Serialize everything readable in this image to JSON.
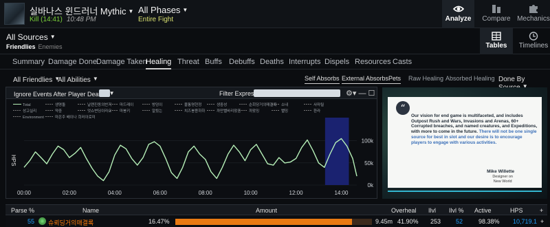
{
  "header": {
    "boss_title": "실바나스 윈드러너 Mythic",
    "kill_status": "Kill (14:41)",
    "kill_time": "10:48 PM",
    "phase_title": "All Phases",
    "phase_subtitle": "Entire Fight",
    "nav": [
      {
        "label": "Analyze",
        "icon": "eye-icon"
      },
      {
        "label": "Compare",
        "icon": "compare-icon"
      },
      {
        "label": "Mechanics",
        "icon": "puzzle-icon"
      }
    ]
  },
  "sources": {
    "title": "All Sources",
    "friendlies": "Friendlies",
    "enemies": "Enemies",
    "views": [
      {
        "label": "Tables",
        "icon": "table-icon"
      },
      {
        "label": "Timelines",
        "icon": "clock-icon"
      }
    ]
  },
  "tabs": [
    "Summary",
    "Damage Done",
    "Damage Taken",
    "Healing",
    "Threat",
    "Buffs",
    "Debuffs",
    "Deaths",
    "Interrupts",
    "Dispels",
    "Resources",
    "Casts"
  ],
  "active_tab": "Healing",
  "filters": {
    "friendlies": "All Friendlies",
    "abilities": "All Abilities",
    "chips": [
      "Self Absorbs",
      "External Absorbs",
      "Pets",
      "Raw Healing",
      "Absorbed Healing"
    ],
    "sort": "Done By Source"
  },
  "chart_header": {
    "ignore_events": "Ignore Events After Player Deaths",
    "filter_expression": "Filter Expression:"
  },
  "chart_data": {
    "type": "line",
    "ylabel": "HPS",
    "x_ticks": [
      "00:00",
      "02:00",
      "04:00",
      "06:00",
      "08:00",
      "10:00",
      "12:00",
      "14:00"
    ],
    "y_ticks": [
      "0k",
      "50k",
      "100k"
    ],
    "ylim": [
      0,
      140000
    ],
    "xlim": [
      0,
      881
    ],
    "highlight_range": [
      797,
      860
    ],
    "color": "#b6f0b8",
    "legend": [
      "Total",
      "생명돌",
      "날랜진동의반지",
      "마드레이",
      "방덩이",
      "불통명현정",
      "생중성",
      "순회당거의매결록",
      "소내",
      "사마릴",
      "성고실리",
      "약중",
      "엇쇼변딩이라요",
      "마봉키",
      "알뤘는",
      "치즈봉용하하",
      "까만뻘바리왔중",
      "까왔밍",
      "뻘밍",
      "환라",
      "Environment",
      "마온주 배이나 희러이로미"
    ],
    "series": [
      {
        "name": "Total",
        "x": [
          0,
          15,
          30,
          45,
          60,
          75,
          90,
          105,
          120,
          135,
          150,
          165,
          180,
          195,
          210,
          225,
          240,
          255,
          270,
          285,
          300,
          315,
          330,
          345,
          360,
          375,
          390,
          405,
          420,
          435,
          450,
          465,
          480,
          495,
          510,
          525,
          540,
          555,
          570,
          585,
          600,
          615,
          630,
          645,
          660,
          675,
          690,
          705,
          720,
          735,
          750,
          765,
          780,
          795,
          810,
          825,
          840,
          855,
          870,
          881
        ],
        "y": [
          40000,
          55000,
          75000,
          62000,
          48000,
          70000,
          88000,
          80000,
          62000,
          72000,
          85000,
          60000,
          38000,
          20000,
          10000,
          30000,
          68000,
          90000,
          82000,
          60000,
          45000,
          62000,
          92000,
          98000,
          88000,
          60000,
          28000,
          15000,
          40000,
          75000,
          88000,
          70000,
          58000,
          30000,
          15000,
          40000,
          70000,
          90000,
          75000,
          55000,
          80000,
          92000,
          70000,
          48000,
          45000,
          62000,
          50000,
          52000,
          60000,
          85000,
          102000,
          78000,
          50000,
          40000,
          70000,
          96000,
          105000,
          88000,
          60000,
          20000
        ]
      }
    ]
  },
  "ad": {
    "quote": "Our vision for end game is multifaceted, and includes Outpost Rush and Wars, Invasions and Arenas, 60+ Corrupted breaches, and named creatures, and Expeditions, with more to come in the future.",
    "quote_highlight": "There will not be one single source for best in slot and our desire is to encourage players to engage with various activities.",
    "name": "Mike Willette",
    "role_line1": "Designer on",
    "role_line2": "New World"
  },
  "table": {
    "headers": [
      "Parse %",
      "Name",
      "Amount",
      "Overheal",
      "Ilvl",
      "Ilvl %",
      "Active",
      "HPS",
      "+"
    ],
    "row": {
      "parse": "55",
      "name": "슈뢰딩거의매결록",
      "percent": "16.47%",
      "amount_fraction": 0.9,
      "amount": "9.45m",
      "overheal": "41.90%",
      "ilvl": "253",
      "ilvl_pct": "52",
      "active": "98.38%",
      "hps": "10,719.1",
      "extra": "+"
    }
  }
}
